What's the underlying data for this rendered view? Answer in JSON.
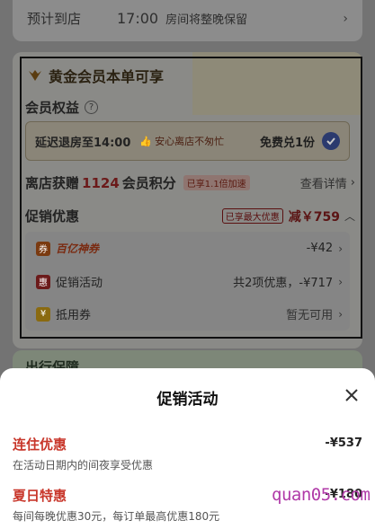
{
  "arrival": {
    "label": "预计到店",
    "time": "17:00",
    "note": "房间将整晚保留"
  },
  "gold_member": {
    "title": "黄金会员本单可享",
    "benefits_header": "会员权益",
    "benefit": {
      "name": "延迟退房至14:00",
      "hint": "安心离店不匆忙",
      "action": "免费兑1份"
    },
    "points": {
      "prefix": "离店获赠",
      "count": "1124",
      "suffix": "会员积分",
      "tag": "已享1.1倍加速",
      "link": "查看详情"
    }
  },
  "promotions": {
    "title": "促销优惠",
    "tag": "已享最大优惠",
    "discount": "减￥759",
    "rows": [
      {
        "label": "百亿神券",
        "value": "-¥42"
      },
      {
        "label": "促销活动",
        "value": "共2项优惠，-¥717"
      },
      {
        "label": "抵用券",
        "value": "暂无可用"
      }
    ]
  },
  "bg_section": {
    "title": "出行保障"
  },
  "sheet": {
    "title": "促销活动",
    "items": [
      {
        "name": "连住优惠",
        "desc": "在活动日期内的间夜享受优惠",
        "price": "-¥537"
      },
      {
        "name": "夏日特惠",
        "desc": "每间每晚优惠30元，每订单最高优惠180元",
        "price": "-¥180"
      }
    ]
  },
  "watermark": "quan05.com",
  "colors": {
    "accent_red": "#c8362a",
    "overlay": "#737373",
    "check_blue": "#2b3a6e"
  }
}
